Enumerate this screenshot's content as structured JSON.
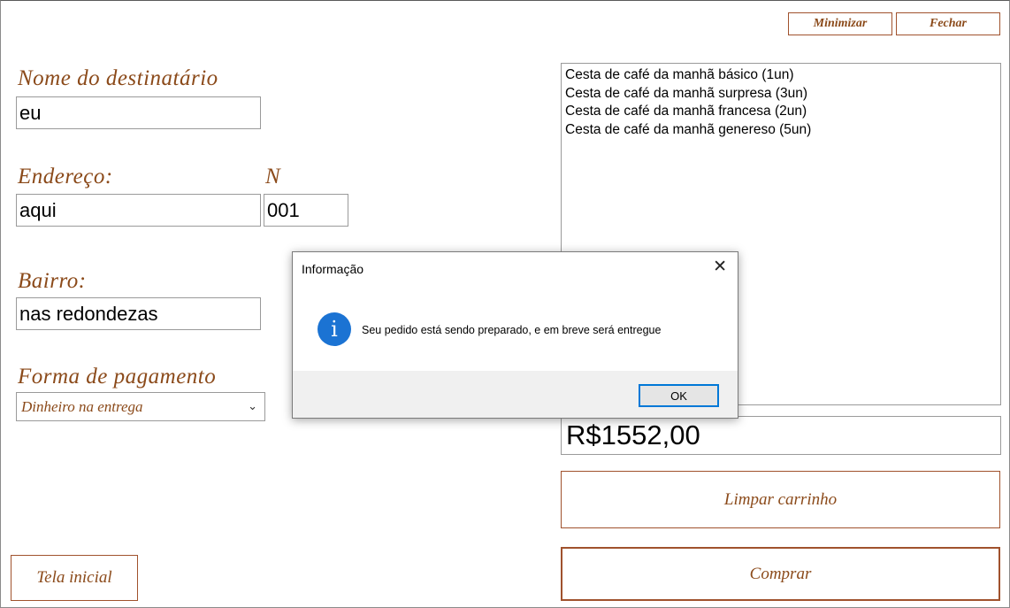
{
  "window": {
    "minimize_label": "Minimizar",
    "close_label": "Fechar"
  },
  "form": {
    "recipient_label": "Nome do destinatário",
    "recipient_value": "eu",
    "address_label": "Endereço:",
    "address_value": "aqui",
    "number_label": "N",
    "number_value": "001",
    "neighborhood_label": "Bairro:",
    "neighborhood_value": "nas redondezas",
    "payment_label": "Forma de pagamento",
    "payment_selected": "Dinheiro na entrega"
  },
  "cart": {
    "items": [
      "Cesta de café da manhã básico (1un)",
      "Cesta de café da manhã surpresa (3un)",
      "Cesta de café da manhã francesa (2un)",
      "Cesta de café da manhã genereso (5un)"
    ],
    "total": "R$1552,00",
    "clear_label": "Limpar carrinho",
    "buy_label": "Comprar"
  },
  "nav": {
    "home_label": "Tela inicial"
  },
  "dialog": {
    "title": "Informação",
    "message": "Seu pedido está sendo preparado, e em breve será entregue",
    "ok_label": "OK",
    "icon": "info-icon",
    "icon_color": "#1b73d3"
  },
  "colors": {
    "accent": "#8b4a1a",
    "border_accent": "#a0522d"
  }
}
